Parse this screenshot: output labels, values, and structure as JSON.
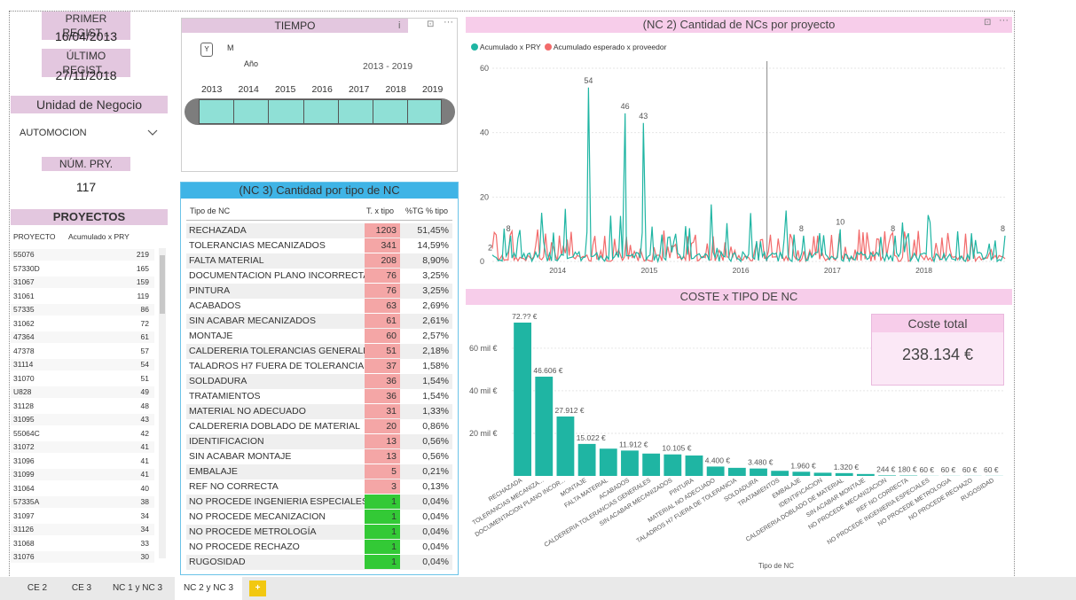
{
  "cards": {
    "primer_label": "PRIMER REGIST...",
    "primer_value": "16/04/2013",
    "ultimo_label": "ÚLTIMO REGIST...",
    "ultimo_value": "27/11/2018",
    "num_label": "NÚM. PRY.",
    "num_value": "117"
  },
  "unidad": {
    "title": "Unidad de Negocio",
    "selected": "AUTOMOCION"
  },
  "tiempo": {
    "title": "TIEMPO",
    "toggle_y": "Y",
    "toggle_m": "M",
    "level": "Año",
    "range": "2013 - 2019",
    "years": [
      "2013",
      "2014",
      "2015",
      "2016",
      "2017",
      "2018",
      "2019"
    ]
  },
  "proyectos": {
    "title": "PROYECTOS",
    "col1": "PROYECTO",
    "col2": "Acumulado x PRY",
    "rows": [
      [
        "55076",
        "219"
      ],
      [
        "57330D",
        "165"
      ],
      [
        "31067",
        "159"
      ],
      [
        "31061",
        "119"
      ],
      [
        "57335",
        "86"
      ],
      [
        "31062",
        "72"
      ],
      [
        "47364",
        "61"
      ],
      [
        "47378",
        "57"
      ],
      [
        "31114",
        "54"
      ],
      [
        "31070",
        "51"
      ],
      [
        "U828",
        "49"
      ],
      [
        "31128",
        "48"
      ],
      [
        "31095",
        "43"
      ],
      [
        "55064C",
        "42"
      ],
      [
        "31072",
        "41"
      ],
      [
        "31096",
        "41"
      ],
      [
        "31099",
        "41"
      ],
      [
        "31064",
        "40"
      ],
      [
        "57335A",
        "38"
      ],
      [
        "31097",
        "34"
      ],
      [
        "31126",
        "34"
      ],
      [
        "31068",
        "33"
      ],
      [
        "31076",
        "30"
      ]
    ]
  },
  "nc3": {
    "title": "(NC 3) Cantidad por tipo de NC",
    "col1": "Tipo de NC",
    "col2": "T. x tipo",
    "col3": "%TG % tipo",
    "rows": [
      [
        "RECHAZADA",
        "1203",
        "51,45%",
        "red"
      ],
      [
        "TOLERANCIAS MECANIZADOS",
        "341",
        "14,59%",
        "red"
      ],
      [
        "FALTA MATERIAL",
        "208",
        "8,90%",
        "red"
      ],
      [
        "DOCUMENTACION PLANO INCORRECTA",
        "76",
        "3,25%",
        "red"
      ],
      [
        "PINTURA",
        "76",
        "3,25%",
        "red"
      ],
      [
        "ACABADOS",
        "63",
        "2,69%",
        "red"
      ],
      [
        "SIN ACABAR MECANIZADOS",
        "61",
        "2,61%",
        "red"
      ],
      [
        "MONTAJE",
        "60",
        "2,57%",
        "red"
      ],
      [
        "CALDERERIA TOLERANCIAS GENERALES",
        "51",
        "2,18%",
        "red"
      ],
      [
        "TALADROS H7 FUERA DE TOLERANCIA",
        "37",
        "1,58%",
        "red"
      ],
      [
        "SOLDADURA",
        "36",
        "1,54%",
        "red"
      ],
      [
        "TRATAMIENTOS",
        "36",
        "1,54%",
        "red"
      ],
      [
        "MATERIAL NO ADECUADO",
        "31",
        "1,33%",
        "red"
      ],
      [
        "CALDERERIA DOBLADO DE MATERIAL",
        "20",
        "0,86%",
        "red"
      ],
      [
        "IDENTIFICACION",
        "13",
        "0,56%",
        "red"
      ],
      [
        "SIN ACABAR MONTAJE",
        "13",
        "0,56%",
        "red"
      ],
      [
        "EMBALAJE",
        "5",
        "0,21%",
        "red"
      ],
      [
        "REF NO CORRECTA",
        "3",
        "0,13%",
        "red"
      ],
      [
        "NO PROCEDE INGENIERIA ESPECIALES",
        "1",
        "0,04%",
        "green"
      ],
      [
        "NO PROCEDE MECANIZACION",
        "1",
        "0,04%",
        "green"
      ],
      [
        "NO PROCEDE METROLOGÍA",
        "1",
        "0,04%",
        "green"
      ],
      [
        "NO PROCEDE RECHAZO",
        "1",
        "0,04%",
        "green"
      ],
      [
        "RUGOSIDAD",
        "1",
        "0,04%",
        "green"
      ]
    ]
  },
  "colors": {
    "teal": "#1fb5a3",
    "red": "#f26b6b",
    "cell_red": "#f4a6a6",
    "cell_green": "#33c936",
    "pink": "#f7cdea"
  },
  "chart_data": [
    {
      "type": "line",
      "title": "(NC 2) Cantidad de NCs por proyecto",
      "series": [
        {
          "name": "Acumulado x PRY",
          "color": "#1fb5a3"
        },
        {
          "name": "Acumulado esperado x proveedor",
          "color": "#f26b6b"
        }
      ],
      "ylim": [
        0,
        60
      ],
      "yticks": [
        "0",
        "20",
        "40",
        "60"
      ],
      "xticks": [
        "2014",
        "2015",
        "2016",
        "2017",
        "2018"
      ],
      "x_range": [
        2013.3,
        2018.9
      ],
      "points": [
        {
          "x": 2013.3,
          "y": 2,
          "label": "2"
        },
        {
          "x": 2013.5,
          "y": 8,
          "label": "8"
        },
        {
          "x": 2014.35,
          "y": 54,
          "label": "54"
        },
        {
          "x": 2014.75,
          "y": 46,
          "label": "46"
        },
        {
          "x": 2014.95,
          "y": 43,
          "label": "43"
        },
        {
          "x": 2016.7,
          "y": 8,
          "label": "8"
        },
        {
          "x": 2017.1,
          "y": 10,
          "label": "10"
        },
        {
          "x": 2017.7,
          "y": 8,
          "label": "8"
        },
        {
          "x": 2018.9,
          "y": 8,
          "label": "8"
        }
      ]
    },
    {
      "type": "bar",
      "title": "COSTE x TIPO DE NC",
      "xlabel": "Tipo de NC",
      "yticks": [
        "20 mil €",
        "40 mil €",
        "60 mil €"
      ],
      "ylim": [
        0,
        72000
      ],
      "categories": [
        "RECHAZADA",
        "TOLERANCIAS MECANIZA...",
        "DOCUMENTACION PLANO INCOR...",
        "MONTAJE",
        "FALTA MATERIAL",
        "ACABADOS",
        "CALDERERIA TOLERANCIAS GENERALES",
        "SIN ACABAR MECANIZADOS",
        "PINTURA",
        "MATERIAL NO ADECUADO",
        "TALADROS H7 FUERA DE TOLERANCIA",
        "SOLDADURA",
        "TRATAMIENTOS",
        "EMBALAJE",
        "IDENTIFICACION",
        "CALDERERIA DOBLADO DE MATERIAL",
        "SIN ACABAR MONTAJE",
        "NO PROCEDE MECANIZACION",
        "REF NO CORRECTA",
        "NO PROCEDE INGENIERIA ESPECIALES",
        "NO PROCEDE METROLOGIA",
        "NO PROCEDE RECHAZO",
        "RUGOSIDAD"
      ],
      "values": [
        72000,
        46606,
        27912,
        15022,
        12800,
        11912,
        10500,
        10105,
        9600,
        4400,
        3800,
        3480,
        2400,
        1960,
        1500,
        1320,
        900,
        244,
        180,
        60,
        60,
        60,
        60
      ],
      "labels": [
        "72.?? €",
        "46.606 €",
        "27.912 €",
        "15.022 €",
        "",
        "11.912 €",
        "",
        "10.105 €",
        "",
        "4.400 €",
        "",
        "3.480 €",
        "",
        "1.960 €",
        "",
        "1.320 €",
        "",
        "244 €",
        "180 €",
        "60 €",
        "60 €",
        "60 €",
        "60 €"
      ]
    }
  ],
  "coste_total": {
    "title": "Coste total",
    "value": "238.134 €"
  },
  "tabs": [
    "CE 2",
    "CE 3",
    "NC 1 y NC 3",
    "NC 2 y NC 3",
    "+"
  ]
}
